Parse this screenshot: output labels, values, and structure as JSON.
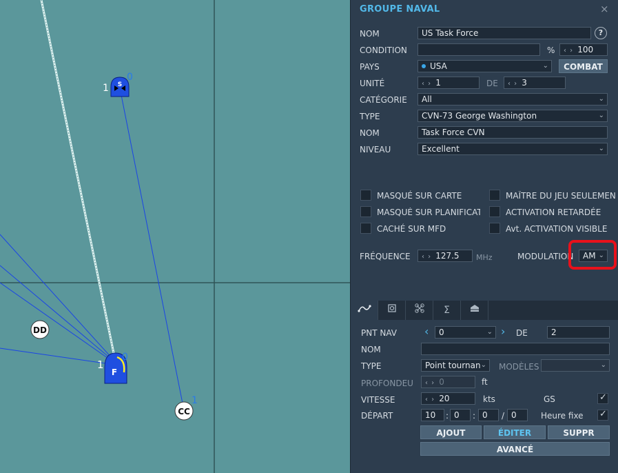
{
  "map": {
    "units": [
      {
        "label": "S",
        "count_left": "1",
        "count_right": "0"
      },
      {
        "label": "F",
        "count_left": "1",
        "count_right": "0"
      },
      {
        "label": "DD"
      },
      {
        "label": "CC",
        "count_right": "1"
      }
    ]
  },
  "panel": {
    "title": "GROUPE NAVAL",
    "close": "×",
    "nom_label": "NOM",
    "nom_value": "US Task Force",
    "help": "?",
    "condition_label": "CONDITION",
    "condition_value": "",
    "percent": "%",
    "condition_pct": "100",
    "pays_label": "PAYS",
    "pays_value": "USA",
    "combat_button": "COMBAT",
    "unite_label": "UNITÉ",
    "unite_value": "1",
    "de_label": "DE",
    "unite_total": "3",
    "categorie_label": "CATÉGORIE",
    "categorie_value": "All",
    "type_label": "TYPE",
    "type_value": "CVN-73 George Washington",
    "nom2_label": "NOM",
    "nom2_value": "Task Force CVN",
    "niveau_label": "NIVEAU",
    "niveau_value": "Excellent",
    "checkboxes": {
      "masque_carte": "MASQUÉ SUR CARTE",
      "masque_planif": "MASQUÉ SUR PLANIFICAT",
      "cache_mfd": "CACHÉ SUR MFD",
      "maitre_jeu": "MAÎTRE DU JEU SEULEMEN",
      "activation_retardee": "ACTIVATION RETARDÉE",
      "avt_activation": "Avt. ACTIVATION VISIBLE"
    },
    "frequence_label": "FRÉQUENCE",
    "frequence_value": "127.5",
    "mhz": "MHz",
    "modulation_label": "MODULATION",
    "modulation_value": "AM",
    "tabs": [
      "path-icon",
      "target-icon",
      "drone-icon",
      "sigma-icon",
      "cargo-icon"
    ],
    "pnt_nav_label": "PNT NAV",
    "pnt_nav_value": "0",
    "pnt_de_label": "DE",
    "pnt_total": "2",
    "wp_nom_label": "NOM",
    "wp_nom_value": "",
    "wp_type_label": "TYPE",
    "wp_type_value": "Point tournan",
    "modeles_label": "MODÈLES",
    "modeles_value": "",
    "profondeur_label": "PROFONDEU",
    "profondeur_value": "0",
    "ft": "ft",
    "vitesse_label": "VITESSE",
    "vitesse_value": "20",
    "kts": "kts",
    "gs_label": "GS",
    "depart_label": "DÉPART",
    "depart_h": "10",
    "depart_m": "0",
    "depart_s": "0",
    "depart_d": "0",
    "colon": ":",
    "slash": "/",
    "heure_fixe_label": "Heure fixe",
    "ajout_button": "AJOUT",
    "editer_button": "ÉDITER",
    "suppr_button": "SUPPR",
    "avance_button": "AVANCÉ"
  },
  "colors": {
    "accent": "#52b8e8",
    "highlight_box": "#e8111b",
    "map_water": "#5b979b",
    "route": "#1a44e6"
  }
}
